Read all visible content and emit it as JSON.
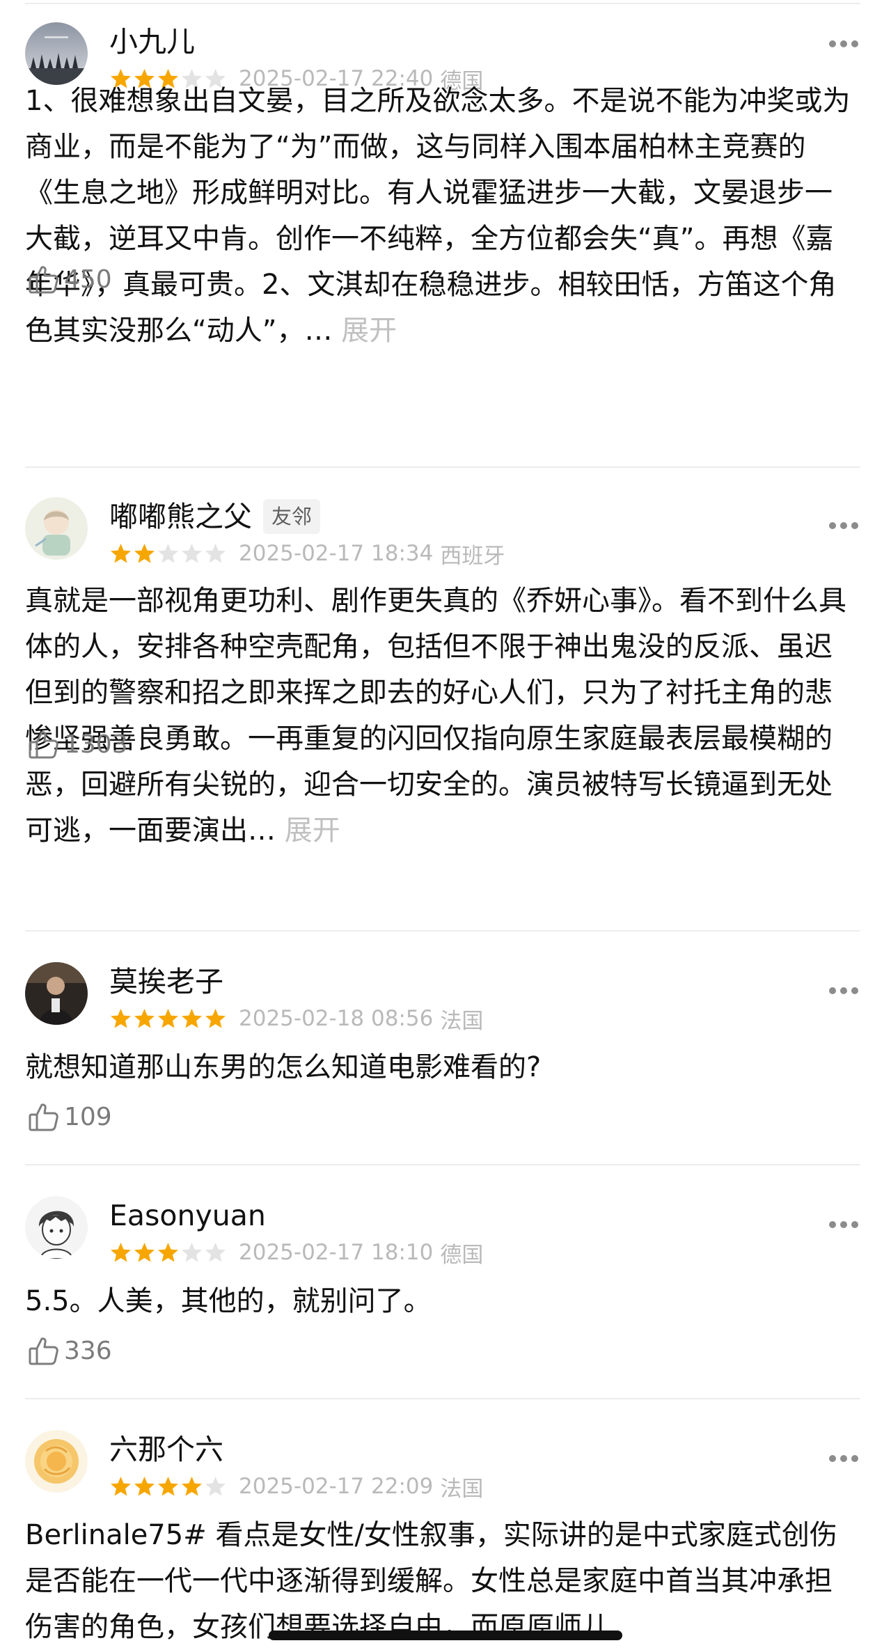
{
  "comments": [
    {
      "user": "小九儿",
      "badge": "",
      "rating": 3,
      "time": "2025-02-17 22:40",
      "location": "德国",
      "text": "1、很难想象出自文晏，目之所及欲念太多。不是说不能为冲奖或为商业，而是不能为了“为”而做，这与同样入围本届柏林主竞赛的《生息之地》形成鲜明对比。有人说霍猛进步一大截，文晏退步一大截，逆耳又中肯。创作一不纯粹，全方位都会失“真”。再想《嘉年华》，真最可贵。2、文淇却在稳稳进步。相较田恬，方笛这个角色其实没那么“动人”，…",
      "expand_label": "展开",
      "likes": "450"
    },
    {
      "user": "嘟嘟熊之父",
      "badge": "友邻",
      "rating": 2,
      "time": "2025-02-17 18:34",
      "location": "西班牙",
      "text": "真就是一部视角更功利、剧作更失真的《乔妍心事》。看不到什么具体的人，安排各种空壳配角，包括但不限于神出鬼没的反派、虽迟但到的警察和招之即来挥之即去的好心人们，只为了衬托主角的悲惨坚强善良勇敢。一再重复的闪回仅指向原生家庭最表层最模糊的恶，回避所有尖锐的，迎合一切安全的。演员被特写长镜逼到无处可逃，一面要演出…",
      "expand_label": "展开",
      "likes": "1303"
    },
    {
      "user": "莫挨老子",
      "badge": "",
      "rating": 5,
      "time": "2025-02-18 08:56",
      "location": "法国",
      "text": "就想知道那山东男的怎么知道电影难看的?",
      "expand_label": "",
      "likes": "109"
    },
    {
      "user": "Easonyuan",
      "badge": "",
      "rating": 3,
      "time": "2025-02-17 18:10",
      "location": "德国",
      "text": "5.5。人美，其他的，就别问了。",
      "expand_label": "",
      "likes": "336"
    },
    {
      "user": "六那个六",
      "badge": "",
      "rating": 4,
      "time": "2025-02-17 22:09",
      "location": "法国",
      "text": "Berlinale75# 看点是女性/女性叙事，实际讲的是中式家庭式创伤是否能在一代一代中逐渐得到缓解。女性总是家庭中首当其冲承担伤害的角色，女孩们想要选择自由，而原原师儿",
      "expand_label": "",
      "likes": ""
    }
  ],
  "colors": {
    "star_filled": "#f7a600",
    "star_empty": "#e3e3e3",
    "meta_text": "#b9b9b9",
    "expand_link": "#c0c0c0",
    "divider": "#ececec"
  },
  "icons": {
    "more": "more-dots-icon",
    "like": "thumbs-up-icon",
    "star": "star-icon"
  }
}
